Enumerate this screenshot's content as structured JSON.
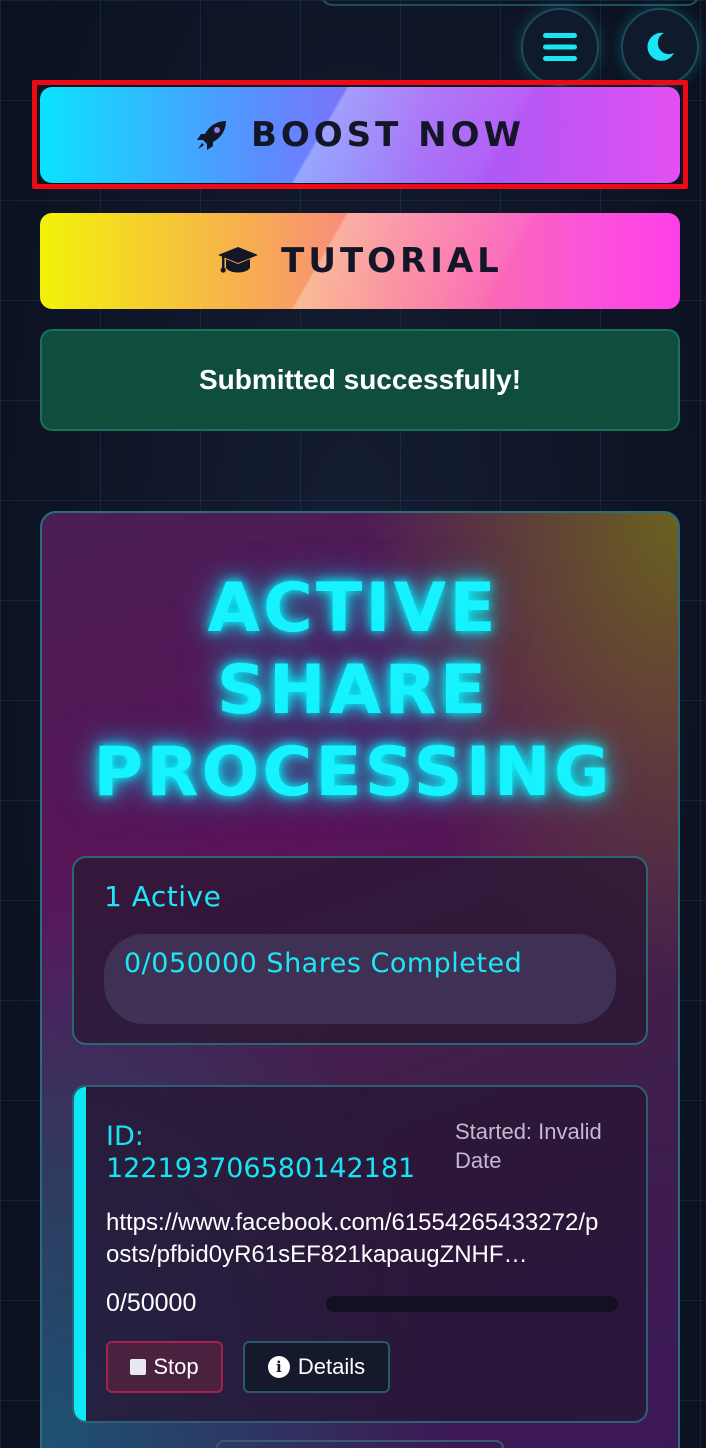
{
  "header": {
    "menu_icon": "hamburger-menu-icon",
    "theme_icon": "crescent-moon-icon"
  },
  "actions": {
    "boost_label": "BOOST NOW",
    "boost_icon": "rocket-icon",
    "tutorial_label": "TUTORIAL",
    "tutorial_icon": "graduation-cap-icon"
  },
  "alert": {
    "message": "Submitted successfully!"
  },
  "panel": {
    "title_line1": "ACTIVE",
    "title_line2": "SHARE",
    "title_line3": "PROCESSING",
    "active_count": "1 Active",
    "shares_summary": "0/050000 Shares Completed"
  },
  "job": {
    "id_label": "ID:",
    "id_value": "122193706580142181",
    "started": "Started: Invalid Date",
    "url": "https://www.facebook.com/61554265433272/posts/pfbid0yR61sEF821kapaugZNHF…",
    "progress_text": "0/50000",
    "progress_fraction": 0,
    "stop_label": "Stop",
    "details_label": "Details"
  },
  "colors": {
    "accent_cyan": "#16f2ff",
    "success_bg": "#0f4d3c",
    "stop_border": "#a3224f"
  }
}
